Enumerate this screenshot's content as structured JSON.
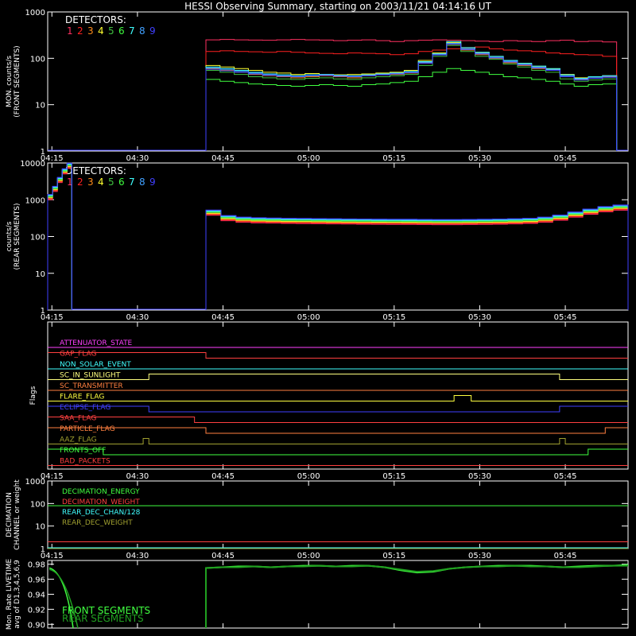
{
  "title": "HESSI Observing Summary, starting on 2003/11/21 04:14:16 UT",
  "colors": {
    "bg": "#000000",
    "fg": "#ffffff",
    "detector_colors": [
      "#ff3060",
      "#ff2020",
      "#ff8c1a",
      "#ffff30",
      "#40c040",
      "#40ff40",
      "#40ffff",
      "#40a0ff",
      "#4040ff"
    ]
  },
  "time_ticks": [
    "04:15",
    "04:30",
    "04:45",
    "05:00",
    "05:15",
    "05:30",
    "05:45"
  ],
  "chart_data": [
    {
      "type": "line",
      "panel": "front",
      "ylabel": [
        "MON. counts/s",
        "(FRONT SEGMENTS)"
      ],
      "yscale": "log",
      "ylim": [
        1,
        1000
      ],
      "yticks": [
        "1",
        "10",
        "100",
        "1000"
      ],
      "legend_title": "DETECTORS:",
      "legend_items": [
        "1",
        "2",
        "3",
        "4",
        "5",
        "6",
        "7",
        "8",
        "9"
      ],
      "xlim": [
        "04:14:16",
        "05:56:00"
      ],
      "data_start": "04:42:00",
      "data_end": "05:54:00",
      "series": [
        {
          "values": [
            250,
            255,
            250,
            248,
            245,
            250,
            255,
            250,
            248,
            240,
            245,
            250,
            240,
            230,
            240,
            245,
            250,
            245,
            240,
            235,
            230,
            240,
            235,
            230,
            240,
            245,
            230,
            235,
            225
          ]
        },
        {
          "values": [
            140,
            145,
            140,
            138,
            135,
            140,
            135,
            130,
            128,
            125,
            130,
            128,
            125,
            120,
            125,
            140,
            150,
            160,
            170,
            175,
            160,
            150,
            145,
            140,
            130,
            125,
            120,
            118,
            110
          ]
        },
        {
          "values": [
            60,
            55,
            50,
            45,
            42,
            40,
            38,
            40,
            42,
            40,
            38,
            42,
            44,
            45,
            48,
            80,
            120,
            200,
            150,
            120,
            100,
            80,
            70,
            60,
            55,
            40,
            35,
            38,
            40
          ]
        },
        {
          "values": [
            70,
            65,
            60,
            55,
            50,
            48,
            45,
            47,
            45,
            44,
            45,
            46,
            48,
            50,
            55,
            90,
            130,
            220,
            160,
            130,
            105,
            85,
            75,
            65,
            58,
            45,
            38,
            40,
            42
          ]
        },
        {
          "values": [
            55,
            50,
            45,
            40,
            38,
            36,
            35,
            37,
            38,
            36,
            35,
            38,
            40,
            42,
            45,
            70,
            110,
            190,
            140,
            110,
            95,
            75,
            65,
            55,
            50,
            36,
            32,
            34,
            36
          ]
        },
        {
          "values": [
            35,
            32,
            30,
            28,
            27,
            26,
            25,
            26,
            27,
            26,
            25,
            27,
            28,
            30,
            32,
            40,
            50,
            60,
            55,
            50,
            45,
            40,
            38,
            35,
            32,
            28,
            25,
            27,
            28
          ]
        },
        {
          "values": [
            65,
            60,
            55,
            50,
            46,
            44,
            42,
            44,
            45,
            43,
            42,
            44,
            46,
            48,
            52,
            85,
            125,
            230,
            170,
            135,
            110,
            90,
            78,
            68,
            60,
            44,
            37,
            40,
            42
          ]
        },
        {
          "values": [
            62,
            58,
            52,
            48,
            45,
            42,
            41,
            43,
            44,
            42,
            41,
            43,
            45,
            47,
            50,
            82,
            122,
            210,
            160,
            128,
            105,
            86,
            74,
            64,
            57,
            42,
            36,
            38,
            41
          ]
        },
        {
          "values": [
            58,
            54,
            50,
            46,
            43,
            41,
            40,
            42,
            43,
            41,
            40,
            42,
            44,
            46,
            49,
            78,
            118,
            200,
            155,
            124,
            102,
            83,
            72,
            62,
            55,
            40,
            34,
            37,
            39
          ]
        }
      ]
    },
    {
      "type": "line",
      "panel": "rear",
      "ylabel": [
        "counts/s",
        "(REAR SEGMENTS)"
      ],
      "yscale": "log",
      "ylim": [
        1,
        10000
      ],
      "yticks": [
        "1",
        "10",
        "100",
        "1000",
        "10000"
      ],
      "legend_title": "DETECTORS:",
      "legend_items": [
        "1",
        "2",
        "3",
        "4",
        "5",
        "6",
        "7",
        "8",
        "9"
      ],
      "segments": [
        {
          "start": "04:14:16",
          "end": "04:18:30",
          "values": [
            1200,
            2000,
            3500,
            6000,
            8500
          ]
        },
        {
          "start": "04:42:00",
          "end": "05:56:00",
          "values": [
            450,
            320,
            290,
            280,
            275,
            270,
            268,
            265,
            262,
            260,
            258,
            256,
            255,
            254,
            252,
            250,
            250,
            252,
            255,
            258,
            262,
            270,
            290,
            330,
            400,
            480,
            560,
            620
          ]
        }
      ]
    },
    {
      "type": "flags",
      "panel": "flags",
      "ylabel": "Flags",
      "flags": [
        {
          "name": "ATTENUATOR_STATE",
          "color": "#ff40ff",
          "steps": [
            [
              "04:14:16",
              0
            ]
          ]
        },
        {
          "name": "GAP_FLAG",
          "color": "#ff4040",
          "steps": [
            [
              "04:14:16",
              1
            ],
            [
              "04:42:00",
              0
            ]
          ]
        },
        {
          "name": "NON_SOLAR_EVENT",
          "color": "#40ffff",
          "steps": [
            [
              "04:14:16",
              0
            ]
          ]
        },
        {
          "name": "SC_IN_SUNLIGHT",
          "color": "#ffff80",
          "steps": [
            [
              "04:14:16",
              0
            ],
            [
              "04:32:00",
              1
            ],
            [
              "05:44:00",
              0
            ],
            [
              "05:48:00",
              0
            ]
          ]
        },
        {
          "name": "SC_TRANSMITTER",
          "color": "#ff8040",
          "steps": [
            [
              "04:14:16",
              0
            ]
          ]
        },
        {
          "name": "FLARE_FLAG",
          "color": "#ffff40",
          "steps": [
            [
              "04:14:16",
              0
            ],
            [
              "05:25:30",
              1
            ],
            [
              "05:28:30",
              0
            ]
          ]
        },
        {
          "name": "ECLIPSE_FLAG",
          "color": "#4040ff",
          "steps": [
            [
              "04:14:16",
              1
            ],
            [
              "04:32:00",
              0
            ],
            [
              "05:44:00",
              1
            ]
          ]
        },
        {
          "name": "SAA_FLAG",
          "color": "#ff4040",
          "steps": [
            [
              "04:14:16",
              1
            ],
            [
              "04:40:00",
              0
            ]
          ]
        },
        {
          "name": "PARTICLE_FLAG",
          "color": "#ff8040",
          "steps": [
            [
              "04:14:16",
              1
            ],
            [
              "04:42:00",
              0
            ],
            [
              "05:52:00",
              1
            ]
          ]
        },
        {
          "name": "AAZ_FLAG",
          "color": "#a0a030",
          "steps": [
            [
              "04:14:16",
              0
            ],
            [
              "04:31:00",
              1
            ],
            [
              "04:32:00",
              0
            ],
            [
              "05:44:00",
              1
            ],
            [
              "05:45:00",
              0
            ]
          ]
        },
        {
          "name": "FRONTS_OFF",
          "color": "#40ff40",
          "steps": [
            [
              "04:14:16",
              1
            ],
            [
              "04:24:00",
              0
            ],
            [
              "05:49:00",
              1
            ]
          ]
        },
        {
          "name": "BAD_PACKETS",
          "color": "#ff4040",
          "steps": [
            [
              "04:14:16",
              0
            ]
          ]
        }
      ]
    },
    {
      "type": "line",
      "panel": "decimation",
      "ylabel": [
        "DECIMATION",
        "CHANNEL or weight"
      ],
      "yscale": "log",
      "ylim": [
        1,
        1000
      ],
      "yticks": [
        "1",
        "10",
        "100",
        "1000"
      ],
      "series": [
        {
          "name": "DECIMATION_ENERGY",
          "color": "#40ff40",
          "value": 80
        },
        {
          "name": "DECIMATION_WEIGHT",
          "color": "#ff4040",
          "value": 2
        },
        {
          "name": "REAR_DEC_CHAN/128",
          "color": "#40ffff",
          "value": 1
        },
        {
          "name": "REAR_DEC_WEIGHT",
          "color": "#a0a030",
          "value": 1
        }
      ]
    },
    {
      "type": "line",
      "panel": "livetime",
      "ylabel": [
        "Mon. Rate LIVETIME",
        "avg of D1,3,4,5,6,9"
      ],
      "ylim": [
        0.895,
        0.985
      ],
      "yticks": [
        "0.90",
        "0.92",
        "0.94",
        "0.96",
        "0.98"
      ],
      "series": [
        {
          "name": "FRONT SEGMENTS",
          "color": "#40ff40",
          "values": [
            0.975,
            0.976,
            0.977,
            0.977,
            0.976,
            0.977,
            0.978,
            0.978,
            0.977,
            0.978,
            0.978,
            0.976,
            0.972,
            0.969,
            0.97,
            0.974,
            0.976,
            0.977,
            0.978,
            0.978,
            0.978,
            0.977,
            0.976,
            0.977,
            0.978,
            0.978,
            0.979
          ]
        },
        {
          "name": "REAR SEGMENTS",
          "color": "#20a020",
          "values": [
            0.975,
            0.976,
            0.976,
            0.977,
            0.976,
            0.977,
            0.977,
            0.978,
            0.977,
            0.977,
            0.978,
            0.976,
            0.973,
            0.97,
            0.971,
            0.974,
            0.976,
            0.977,
            0.977,
            0.978,
            0.977,
            0.977,
            0.976,
            0.976,
            0.977,
            0.978,
            0.978
          ]
        }
      ]
    }
  ]
}
